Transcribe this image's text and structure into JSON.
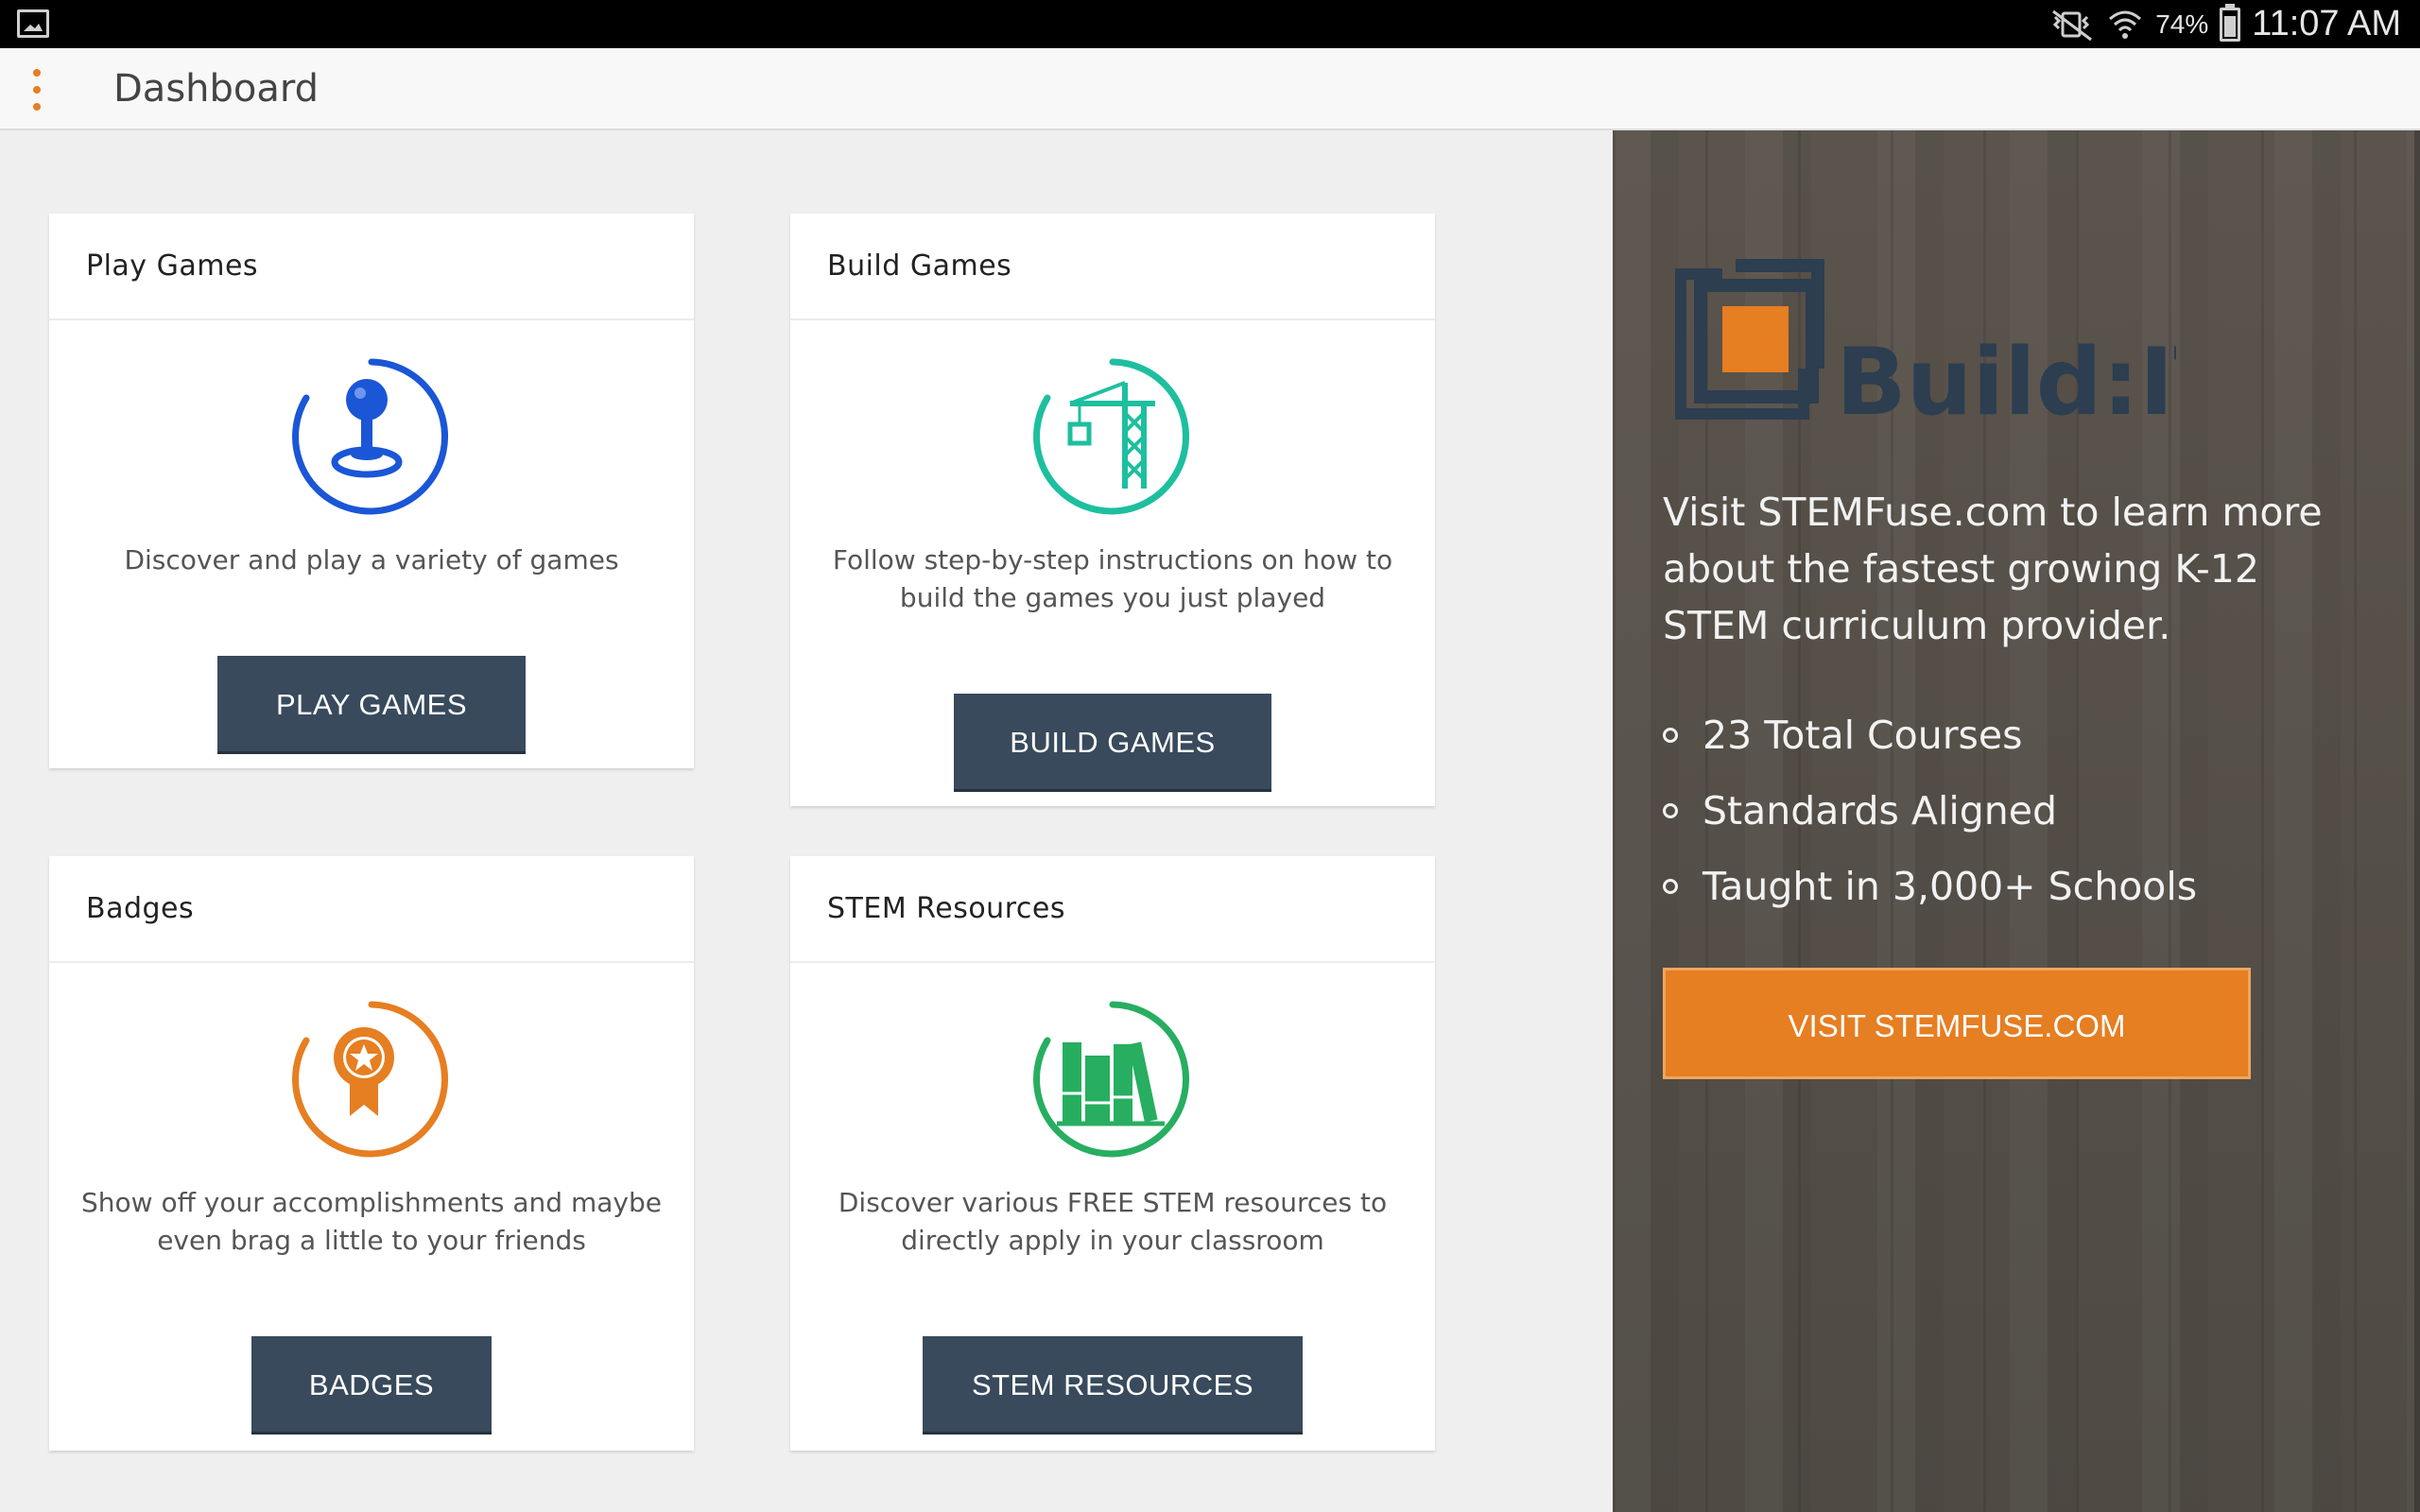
{
  "status_bar": {
    "battery": "74%",
    "time": "11:07 AM"
  },
  "app_bar": {
    "title": "Dashboard"
  },
  "cards": [
    {
      "title": "Play Games",
      "description": "Discover and play a variety of games",
      "button": "PLAY GAMES",
      "icon": "joystick-icon",
      "color": "#1a56d6"
    },
    {
      "title": "Build Games",
      "description": "Follow step-by-step instructions on how to build the games you just played",
      "button": "BUILD GAMES",
      "icon": "crane-icon",
      "color": "#1dbf9f"
    },
    {
      "title": "Badges",
      "description": "Show off your accomplishments and maybe even brag a little to your friends",
      "button": "BADGES",
      "icon": "badge-icon",
      "color": "#e67e22"
    },
    {
      "title": "STEM Resources",
      "description": "Discover various FREE STEM resources to directly apply in your classroom",
      "button": "STEM RESOURCES",
      "icon": "books-icon",
      "color": "#27ae60"
    }
  ],
  "promo": {
    "logo_text": "Build:IT",
    "text": "Visit STEMFuse.com to learn more about the fastest growing K-12 STEM curriculum provider.",
    "bullets": [
      "23 Total Courses",
      "Standards Aligned",
      "Taught in 3,000+ Schools"
    ],
    "button": "VISIT STEMFUSE.COM"
  },
  "colors": {
    "accent": "#e67e22",
    "button_dark": "#384a5c"
  }
}
